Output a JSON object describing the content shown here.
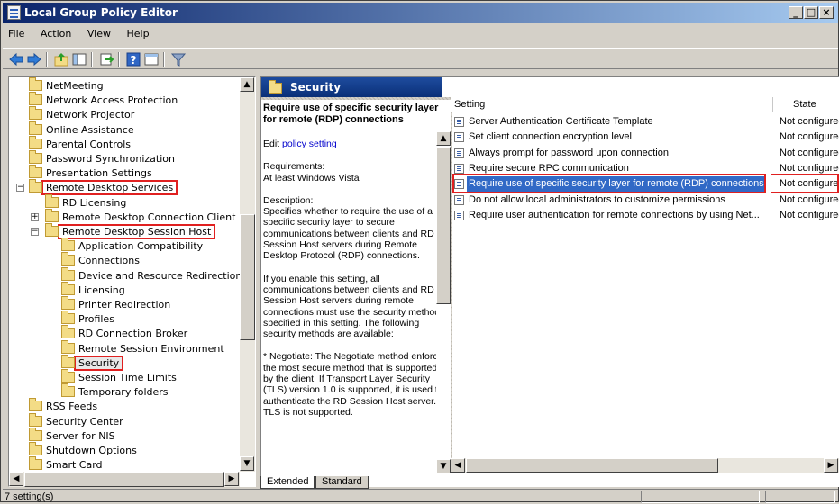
{
  "window": {
    "title": "Local Group Policy Editor"
  },
  "menu": [
    "File",
    "Action",
    "View",
    "Help"
  ],
  "tree": {
    "items": [
      {
        "label": "NetMeeting"
      },
      {
        "label": "Network Access Protection"
      },
      {
        "label": "Network Projector"
      },
      {
        "label": "Online Assistance"
      },
      {
        "label": "Parental Controls"
      },
      {
        "label": "Password Synchronization"
      },
      {
        "label": "Presentation Settings"
      },
      {
        "label": "Remote Desktop Services",
        "expander": "−",
        "highlighted": true
      },
      {
        "label": "RD Licensing"
      },
      {
        "label": "Remote Desktop Connection Client",
        "expander": "+"
      },
      {
        "label": "Remote Desktop Session Host",
        "expander": "−",
        "highlighted": true
      },
      {
        "label": "Application Compatibility"
      },
      {
        "label": "Connections"
      },
      {
        "label": "Device and Resource Redirection"
      },
      {
        "label": "Licensing"
      },
      {
        "label": "Printer Redirection"
      },
      {
        "label": "Profiles"
      },
      {
        "label": "RD Connection Broker"
      },
      {
        "label": "Remote Session Environment"
      },
      {
        "label": "Security",
        "highlighted": true,
        "selected": true
      },
      {
        "label": "Session Time Limits"
      },
      {
        "label": "Temporary folders"
      },
      {
        "label": "RSS Feeds"
      },
      {
        "label": "Security Center"
      },
      {
        "label": "Server for NIS"
      },
      {
        "label": "Shutdown Options"
      },
      {
        "label": "Smart Card"
      }
    ]
  },
  "right": {
    "header": "Security",
    "description": {
      "title": "Require use of specific security layer for remote (RDP) connections",
      "edit_prefix": "Edit ",
      "edit_link": "policy setting ",
      "requirements_label": "Requirements:",
      "requirements_value": "At least Windows Vista",
      "description_label": "Description:",
      "p1": "Specifies whether to require the use of a specific security layer to secure communications between clients and RD Session Host servers during Remote Desktop Protocol (RDP) connections.",
      "p2": "If you enable this setting, all communications between clients and RD Session Host servers during remote connections must use the security method specified in this setting. The following security methods are available:",
      "p3": "* Negotiate: The Negotiate method enforces the most secure method that is supported by the client. If Transport Layer Security (TLS) version 1.0 is supported, it is used to authenticate the RD Session Host server. If TLS is not supported."
    },
    "columns": {
      "setting": "Setting",
      "state": "State"
    },
    "rows": [
      {
        "name": "Server Authentication Certificate Template",
        "state": "Not configured"
      },
      {
        "name": "Set client connection encryption level",
        "state": "Not configured"
      },
      {
        "name": "Always prompt for password upon connection",
        "state": "Not configured"
      },
      {
        "name": "Require secure RPC communication",
        "state": "Not configured"
      },
      {
        "name": "Require use of specific security layer for remote (RDP) connections",
        "state": "Not configured",
        "selected": true
      },
      {
        "name": "Do not allow local administrators to customize permissions",
        "state": "Not configured"
      },
      {
        "name": "Require user authentication for remote connections by using Net...",
        "state": "Not configured"
      }
    ]
  },
  "tabs": [
    "Extended",
    "Standard"
  ],
  "status": {
    "text": "7 setting(s)"
  }
}
